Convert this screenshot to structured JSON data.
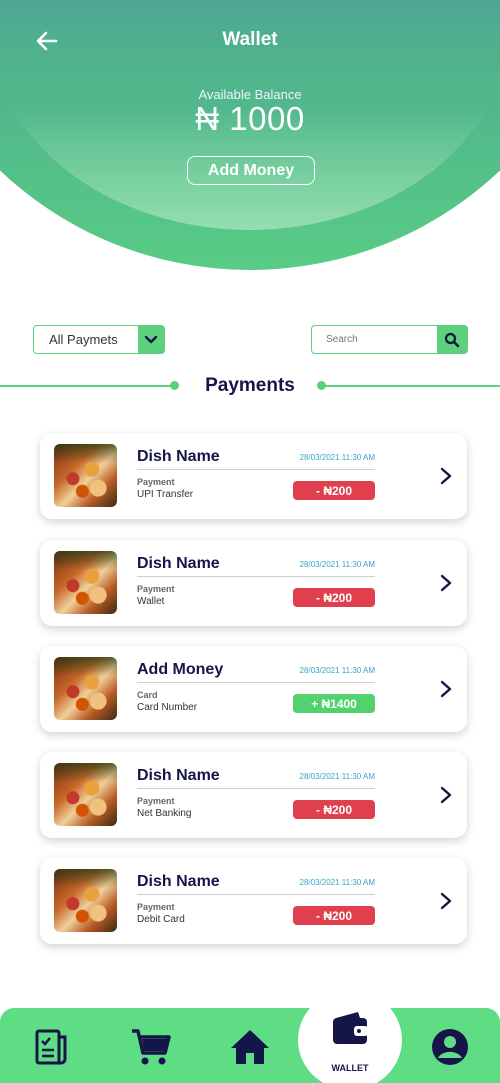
{
  "header": {
    "title": "Wallet",
    "balance_label": "Available Balance",
    "balance": "₦ 1000",
    "add_money": "Add Money"
  },
  "filters": {
    "selected": "All Paymets",
    "search_placeholder": "Search"
  },
  "section_title": "Payments",
  "payments": [
    {
      "title": "Dish Name",
      "date": "28/03/2021  11:30 AM",
      "label": "Payment",
      "value": "UPI Transfer",
      "amount": "- ₦200",
      "type": "debit"
    },
    {
      "title": "Dish Name",
      "date": "28/03/2021  11:30 AM",
      "label": "Payment",
      "value": "Wallet",
      "amount": "- ₦200",
      "type": "debit"
    },
    {
      "title": "Add Money",
      "date": "28/03/2021  11:30 AM",
      "label": "Card",
      "value": "Card Number",
      "amount": "+ ₦1400",
      "type": "credit"
    },
    {
      "title": "Dish Name",
      "date": "28/03/2021  11:30 AM",
      "label": "Payment",
      "value": "Net Banking",
      "amount": "- ₦200",
      "type": "debit"
    },
    {
      "title": "Dish Name",
      "date": "28/03/2021  11:30 AM",
      "label": "Payment",
      "value": "Debit Card",
      "amount": "- ₦200",
      "type": "debit"
    }
  ],
  "bottom_nav": {
    "items": [
      "orders-icon",
      "cart-icon",
      "home-icon",
      "wallet-icon",
      "profile-icon"
    ],
    "active_label": "WALLET"
  },
  "colors": {
    "accent": "#5dd07e",
    "debit": "#e0404e",
    "credit": "#52d16f",
    "navy": "#15154a",
    "header_top": "#3f5fa8"
  }
}
